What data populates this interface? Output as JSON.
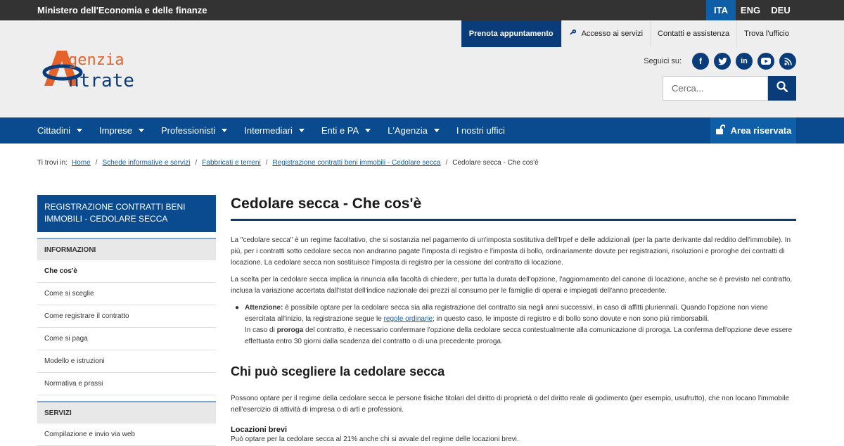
{
  "topbar": {
    "ministry": "Ministero dell'Economia e delle finanze",
    "languages": [
      "ITA",
      "ENG",
      "DEU"
    ],
    "active_language": "ITA"
  },
  "utility_nav": {
    "book": "Prenota appuntamento",
    "access": "Accesso ai servizi",
    "contacts": "Contatti e assistenza",
    "office": "Trova l'ufficio"
  },
  "logo": {
    "line1": "genzia",
    "line2": "ntrate"
  },
  "social": {
    "label": "Seguici su:",
    "icons": [
      "facebook-icon",
      "twitter-icon",
      "linkedin-icon",
      "youtube-icon",
      "rss-icon"
    ]
  },
  "search": {
    "placeholder": "Cerca..."
  },
  "mainnav": {
    "items": [
      "Cittadini",
      "Imprese",
      "Professionisti",
      "Intermediari",
      "Enti e PA",
      "L'Agenzia",
      "I nostri uffici"
    ],
    "area": "Area riservata"
  },
  "breadcrumb": {
    "prefix": "Ti trovi in:",
    "items": [
      "Home",
      "Schede informative e servizi",
      "Fabbricati e terreni",
      "Registrazione contratti beni immobili - Cedolare secca"
    ],
    "current": "Cedolare secca - Che cos'è"
  },
  "sidebar": {
    "title": "REGISTRAZIONE CONTRATTI BENI IMMOBILI - CEDOLARE SECCA",
    "section1": "INFORMAZIONI",
    "items": [
      "Che cos'è",
      "Come si sceglie",
      "Come registrare il contratto",
      "Come si paga",
      "Modello e istruzioni",
      "Normativa e prassi"
    ],
    "section2": "SERVIZI",
    "items2": [
      "Compilazione e invio via web"
    ]
  },
  "content": {
    "title": "Cedolare secca - Che cos'è",
    "p1": "La \"cedolare secca\" è un regime facoltativo, che si sostanzia nel pagamento di un'imposta sostitutiva dell'Irpef e delle addizionali (per la parte derivante dal reddito dell'immobile). In più, per i contratti sotto cedolare secca non andranno pagate l'imposta di registro e l'imposta di bollo, ordinariamente dovute per registrazioni, risoluzioni e proroghe dei contratti di locazione. La cedolare secca non sostituisce l'imposta di registro per la cessione del contratto di locazione.",
    "p2": "La scelta per la cedolare secca implica la rinuncia alla facoltà di chiedere, per tutta la durata dell'opzione, l'aggiornamento del canone di locazione, anche se è previsto nel contratto, inclusa la variazione accertata dall'Istat dell'indice nazionale dei prezzi al consumo per le famiglie di operai e impiegati dell'anno precedente.",
    "attn_label": "Attenzione:",
    "attn_text1": " è possibile optare per la cedolare secca sia alla registrazione del contratto sia negli anni successivi, in caso di affitti pluriennali. Quando l'opzione non viene esercitata all'inizio, la registrazione segue le ",
    "attn_link": "regole ordinarie",
    "attn_text2": "; in questo caso, le imposte di registro e di bollo sono dovute e non sono più rimborsabili.",
    "attn_text3": "In caso di ",
    "attn_bold": "proroga",
    "attn_text4": " del contratto, è necessario confermare l'opzione della cedolare secca contestualmente alla comunicazione di proroga. La conferma dell'opzione deve essere effettuata entro 30 giorni dalla scadenza del contratto o di una precedente proroga.",
    "h2": "Chi può scegliere la cedolare secca",
    "p3": "Possono optare per il regime della cedolare secca le persone fisiche titolari del diritto di proprietà o del diritto reale di godimento (per esempio, usufrutto), che non locano l'immobile nell'esercizio di attività di impresa o di arti e professioni.",
    "h3": "Locazioni brevi",
    "p4": "Può optare per la cedolare secca al 21% anche chi si avvale del regime delle locazioni brevi."
  },
  "colors": {
    "navy": "#0a3c7a",
    "blue": "#0a4a8e",
    "accent": "#0f5fa8",
    "orange": "#e5622b"
  }
}
